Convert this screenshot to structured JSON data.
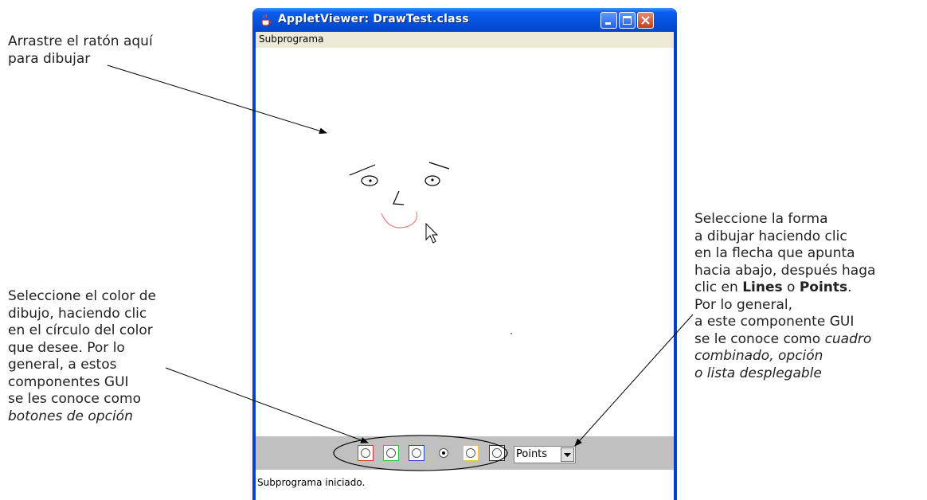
{
  "window": {
    "title": "AppletViewer: DrawTest.class",
    "menu": {
      "label": "Subprograma"
    },
    "status": "Subprograma iniciado."
  },
  "controls": {
    "color_options": [
      {
        "color": "#e03030",
        "selected": false
      },
      {
        "color": "#30c040",
        "selected": false
      },
      {
        "color": "#3040d0",
        "selected": false
      },
      {
        "color": "#ffc0c8",
        "selected": true
      },
      {
        "color": "#f0c040",
        "selected": false
      },
      {
        "color": "#303030",
        "selected": false
      }
    ],
    "shape_choice": {
      "value": "Points"
    }
  },
  "annotations": {
    "drag": {
      "line1": "Arrastre el ratón aquí",
      "line2": "para dibujar"
    },
    "color": {
      "line1": "Seleccione el color de",
      "line2": "dibujo, haciendo clic",
      "line3": "en el círculo del color",
      "line4": "que desee. Por lo",
      "line5": "general, a estos",
      "line6": "componentes GUI",
      "line7": "se les conoce como",
      "line8": "botones de opción"
    },
    "shape": {
      "line1": "Seleccione la forma",
      "line2": "a dibujar haciendo clic",
      "line3": "en la flecha que apunta",
      "line4": "hacia abajo, después haga",
      "line5_pre": "clic en ",
      "line5_b1": "Lines",
      "line5_mid": " o ",
      "line5_b2": "Points",
      "line5_post": ".",
      "line6": "Por lo general,",
      "line7": "a este componente GUI",
      "line8_pre": "se le conoce como ",
      "line8_em": "cuadro",
      "line9": "combinado, opción",
      "line10": "o lista desplegable"
    }
  },
  "colors": {
    "titlebar": "#0450dc",
    "panel": "#c0c0c0",
    "menubar": "#ece9d8",
    "drawing_red": "#f08080"
  }
}
